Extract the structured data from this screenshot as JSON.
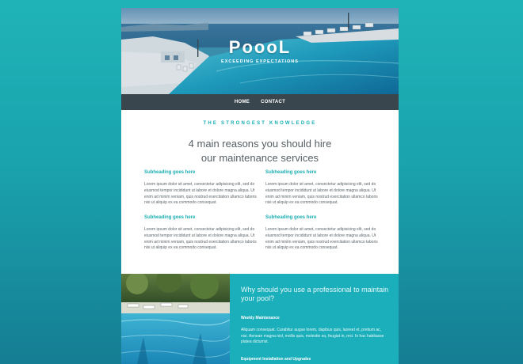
{
  "hero": {
    "brand": "PoooL",
    "tagline": "EXCEEDING EXPECTATIONS"
  },
  "nav": {
    "items": [
      "HOME",
      "CONTACT"
    ]
  },
  "main": {
    "eyebrow": "THE STRONGEST KNOWLEDGE",
    "headline_line1": "4 main reasons you should hire",
    "headline_line2": "our maintenance services",
    "blocks": [
      {
        "heading": "Subheading goes here",
        "text": "Lorem ipsum dolor sit amet, consectetur adipisicing elit, sed do eiusmod tempor incididunt ut labore et dolore magna aliqua. Ut enim ad minim veniam, quis nostrud exercitation ullamco laboris nisi ut aliquip ex ea commodo consequat."
      },
      {
        "heading": "Subheading goes here",
        "text": "Lorem ipsum dolor sit amet, consectetur adipisicing elit, sed do eiusmod tempor incididunt ut labore et dolore magna aliqua. Ut enim ad minim veniam, quis nostrud exercitation ullamco laboris nisi ut aliquip ex ea commodo consequat."
      },
      {
        "heading": "Subheading goes here",
        "text": "Lorem ipsum dolor sit amet, consectetur adipisicing elit, sed do eiusmod tempor incididunt ut labore et dolore magna aliqua. Ut enim ad minim veniam, quis nostrud exercitation ullamco laboris nisi ut aliquip ex ea commodo consequat."
      },
      {
        "heading": "Subheading goes here",
        "text": "Lorem ipsum dolor sit amet, consectetur adipisicing elit, sed do eiusmod tempor incididunt ut labore et dolore magna aliqua. Ut enim ad minim veniam, quis nostrud exercitation ullamco laboris nisi ut aliquip ex ea commodo consequat."
      }
    ]
  },
  "bottom": {
    "title": "Why should you use a professional to maintain your pool?",
    "items": [
      {
        "heading": "Weekly Maintenance",
        "text": "Aliquam consequat. Curabitur augue lorem, dapibus quis, laoreet et, pretium ac, nisi. Aenean magna nisl, mollis quis, molestie eu, feugiat in, orci. In hac habitasse platea dictumst."
      },
      {
        "heading": "Equipment Installation and Upgrades",
        "text": ""
      }
    ]
  },
  "colors": {
    "accent": "#19aeb4",
    "nav_bg": "#3a464d",
    "panel_bg": "#1aafba",
    "page_bg": "#1aa3ad"
  }
}
